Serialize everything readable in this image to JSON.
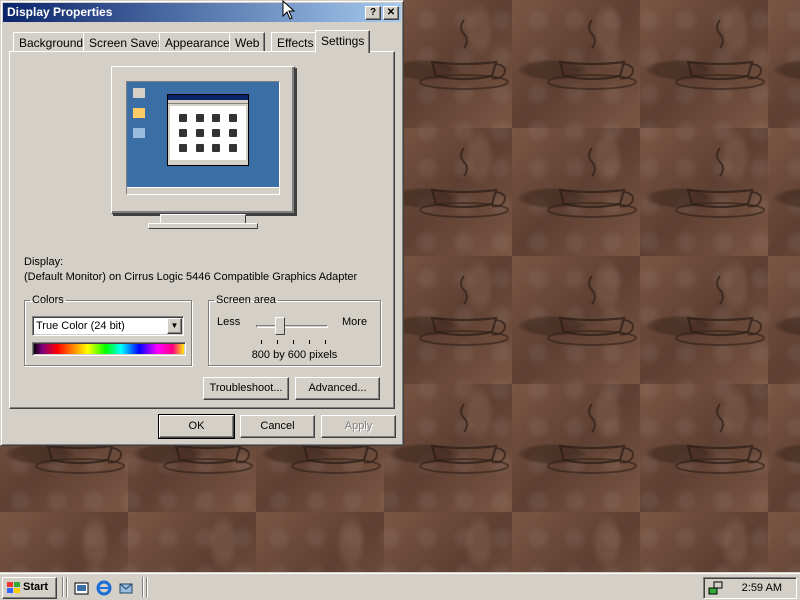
{
  "window": {
    "title": "Display Properties",
    "help_button": "?",
    "close_button": "✕",
    "tabs": [
      "Background",
      "Screen Saver",
      "Appearance",
      "Web",
      "Effects",
      "Settings"
    ],
    "active_tab": "Settings"
  },
  "settings": {
    "display_label": "Display:",
    "display_value": "(Default Monitor) on Cirrus Logic 5446 Compatible Graphics Adapter",
    "colors": {
      "legend": "Colors",
      "selected": "True Color (24 bit)"
    },
    "screen_area": {
      "legend": "Screen area",
      "less_label": "Less",
      "more_label": "More",
      "resolution": "800 by 600 pixels",
      "slider_fraction": 0.33
    },
    "troubleshoot_label": "Troubleshoot...",
    "advanced_label": "Advanced..."
  },
  "buttons": {
    "ok": "OK",
    "cancel": "Cancel",
    "apply": "Apply"
  },
  "taskbar": {
    "start_label": "Start",
    "quick_launch_icons": [
      "show-desktop-icon",
      "internet-explorer-icon",
      "outlook-express-icon"
    ],
    "tray_icons": [
      "network-icon"
    ],
    "clock": "2:59 AM"
  },
  "colors": {
    "title_bar_start": "#0a246a",
    "title_bar_end": "#a6caf0",
    "face": "#d4d0c8",
    "desktop_background": "#6b4a39",
    "preview_desktop": "#3a6ea5"
  }
}
